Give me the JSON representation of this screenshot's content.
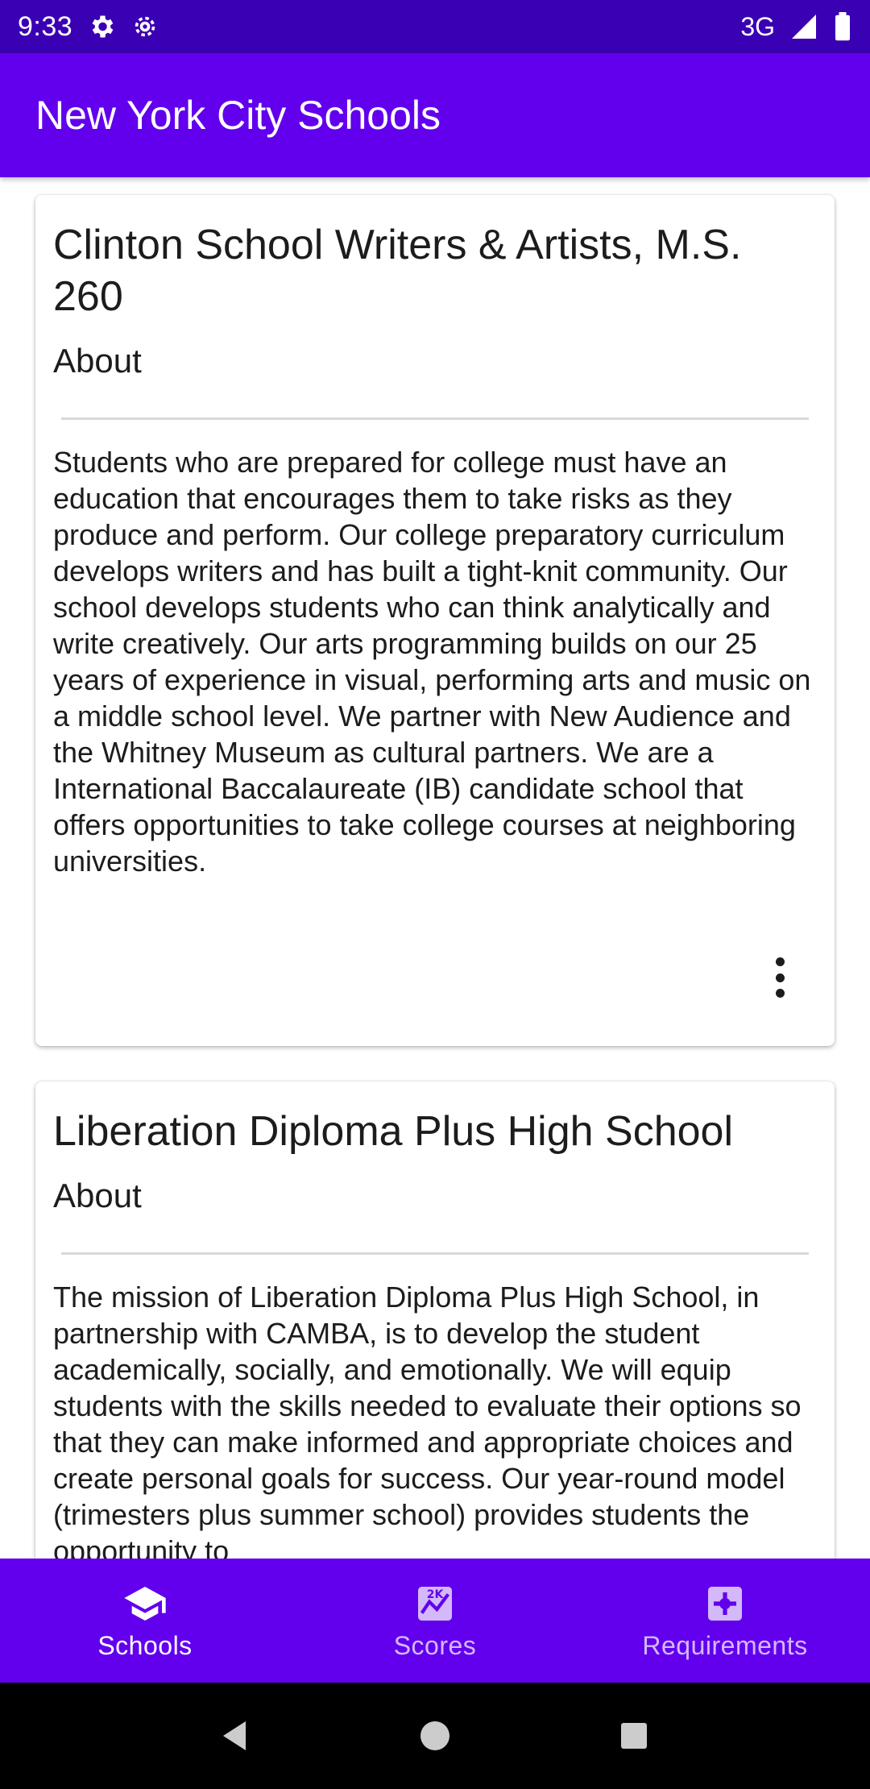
{
  "status_bar": {
    "time": "9:33",
    "network": "3G",
    "icons": [
      "settings-icon",
      "settings-alt-icon",
      "signal-icon",
      "battery-icon"
    ]
  },
  "app_bar": {
    "title": "New York City Schools"
  },
  "schools": [
    {
      "name": "Clinton School Writers & Artists, M.S. 260",
      "about_label": "About",
      "overview": "Students who are prepared for college must have an education that encourages them to take risks as they produce and perform. Our college preparatory curriculum develops writers and has built a tight-knit community. Our school develops students who can think analytically and write creatively. Our arts programming builds on our 25 years of experience in visual, performing arts and music on a middle school level. We partner with New Audience and the Whitney Museum as cultural partners. We are a International Baccalaureate (IB) candidate school that offers opportunities to take college courses at neighboring universities."
    },
    {
      "name": "Liberation Diploma Plus High School",
      "about_label": "About",
      "overview": "The mission of Liberation Diploma Plus High School, in partnership with CAMBA, is to develop the student academically, socially, and emotionally. We will equip students with the skills needed to evaluate their options so that they can make informed and appropriate choices and create personal goals for success. Our year-round model (trimesters plus summer school) provides students the opportunity to"
    }
  ],
  "bottom_nav": {
    "items": [
      {
        "label": "Schools",
        "icon": "school-icon",
        "active": true
      },
      {
        "label": "Scores",
        "icon": "scores-icon",
        "active": false
      },
      {
        "label": "Requirements",
        "icon": "requirements-icon",
        "active": false
      }
    ]
  },
  "colors": {
    "primary": "#6200ee",
    "status_bar": "#3a00b3",
    "system_nav": "#000000"
  }
}
